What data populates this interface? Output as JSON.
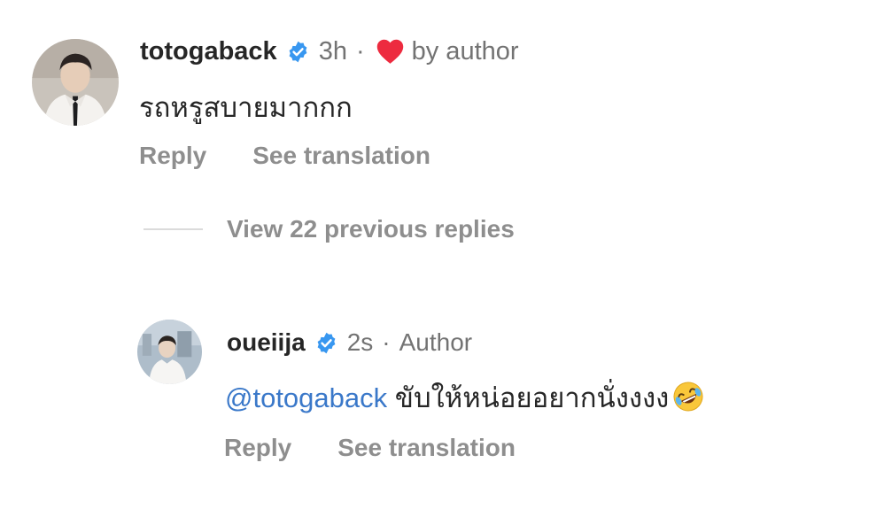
{
  "colors": {
    "text_primary": "#262626",
    "text_secondary": "#737373",
    "action_text": "#8e8e8e",
    "mention": "#3a78c9",
    "verified_badge": "#3897f0",
    "liked_heart": "#ed2b3f"
  },
  "comment": {
    "username": "totogaback",
    "verified_icon": "verified-badge-icon",
    "time": "3h",
    "separator": "·",
    "liked_icon": "heart-icon",
    "liked_label": "by author",
    "text": "รถหรูสบายมากกก",
    "actions": {
      "reply": "Reply",
      "see_translation": "See translation"
    }
  },
  "thread": {
    "view_replies_label": "View 22 previous replies"
  },
  "reply": {
    "username": "oueiija",
    "verified_icon": "verified-badge-icon",
    "time": "2s",
    "separator": "·",
    "author_tag": "Author",
    "mention": "@totogaback",
    "text": " ขับให้หน่อยอยากนั่งงงง",
    "emoji_icon": "rolling-on-floor-laughing-emoji",
    "actions": {
      "reply": "Reply",
      "see_translation": "See translation"
    }
  }
}
